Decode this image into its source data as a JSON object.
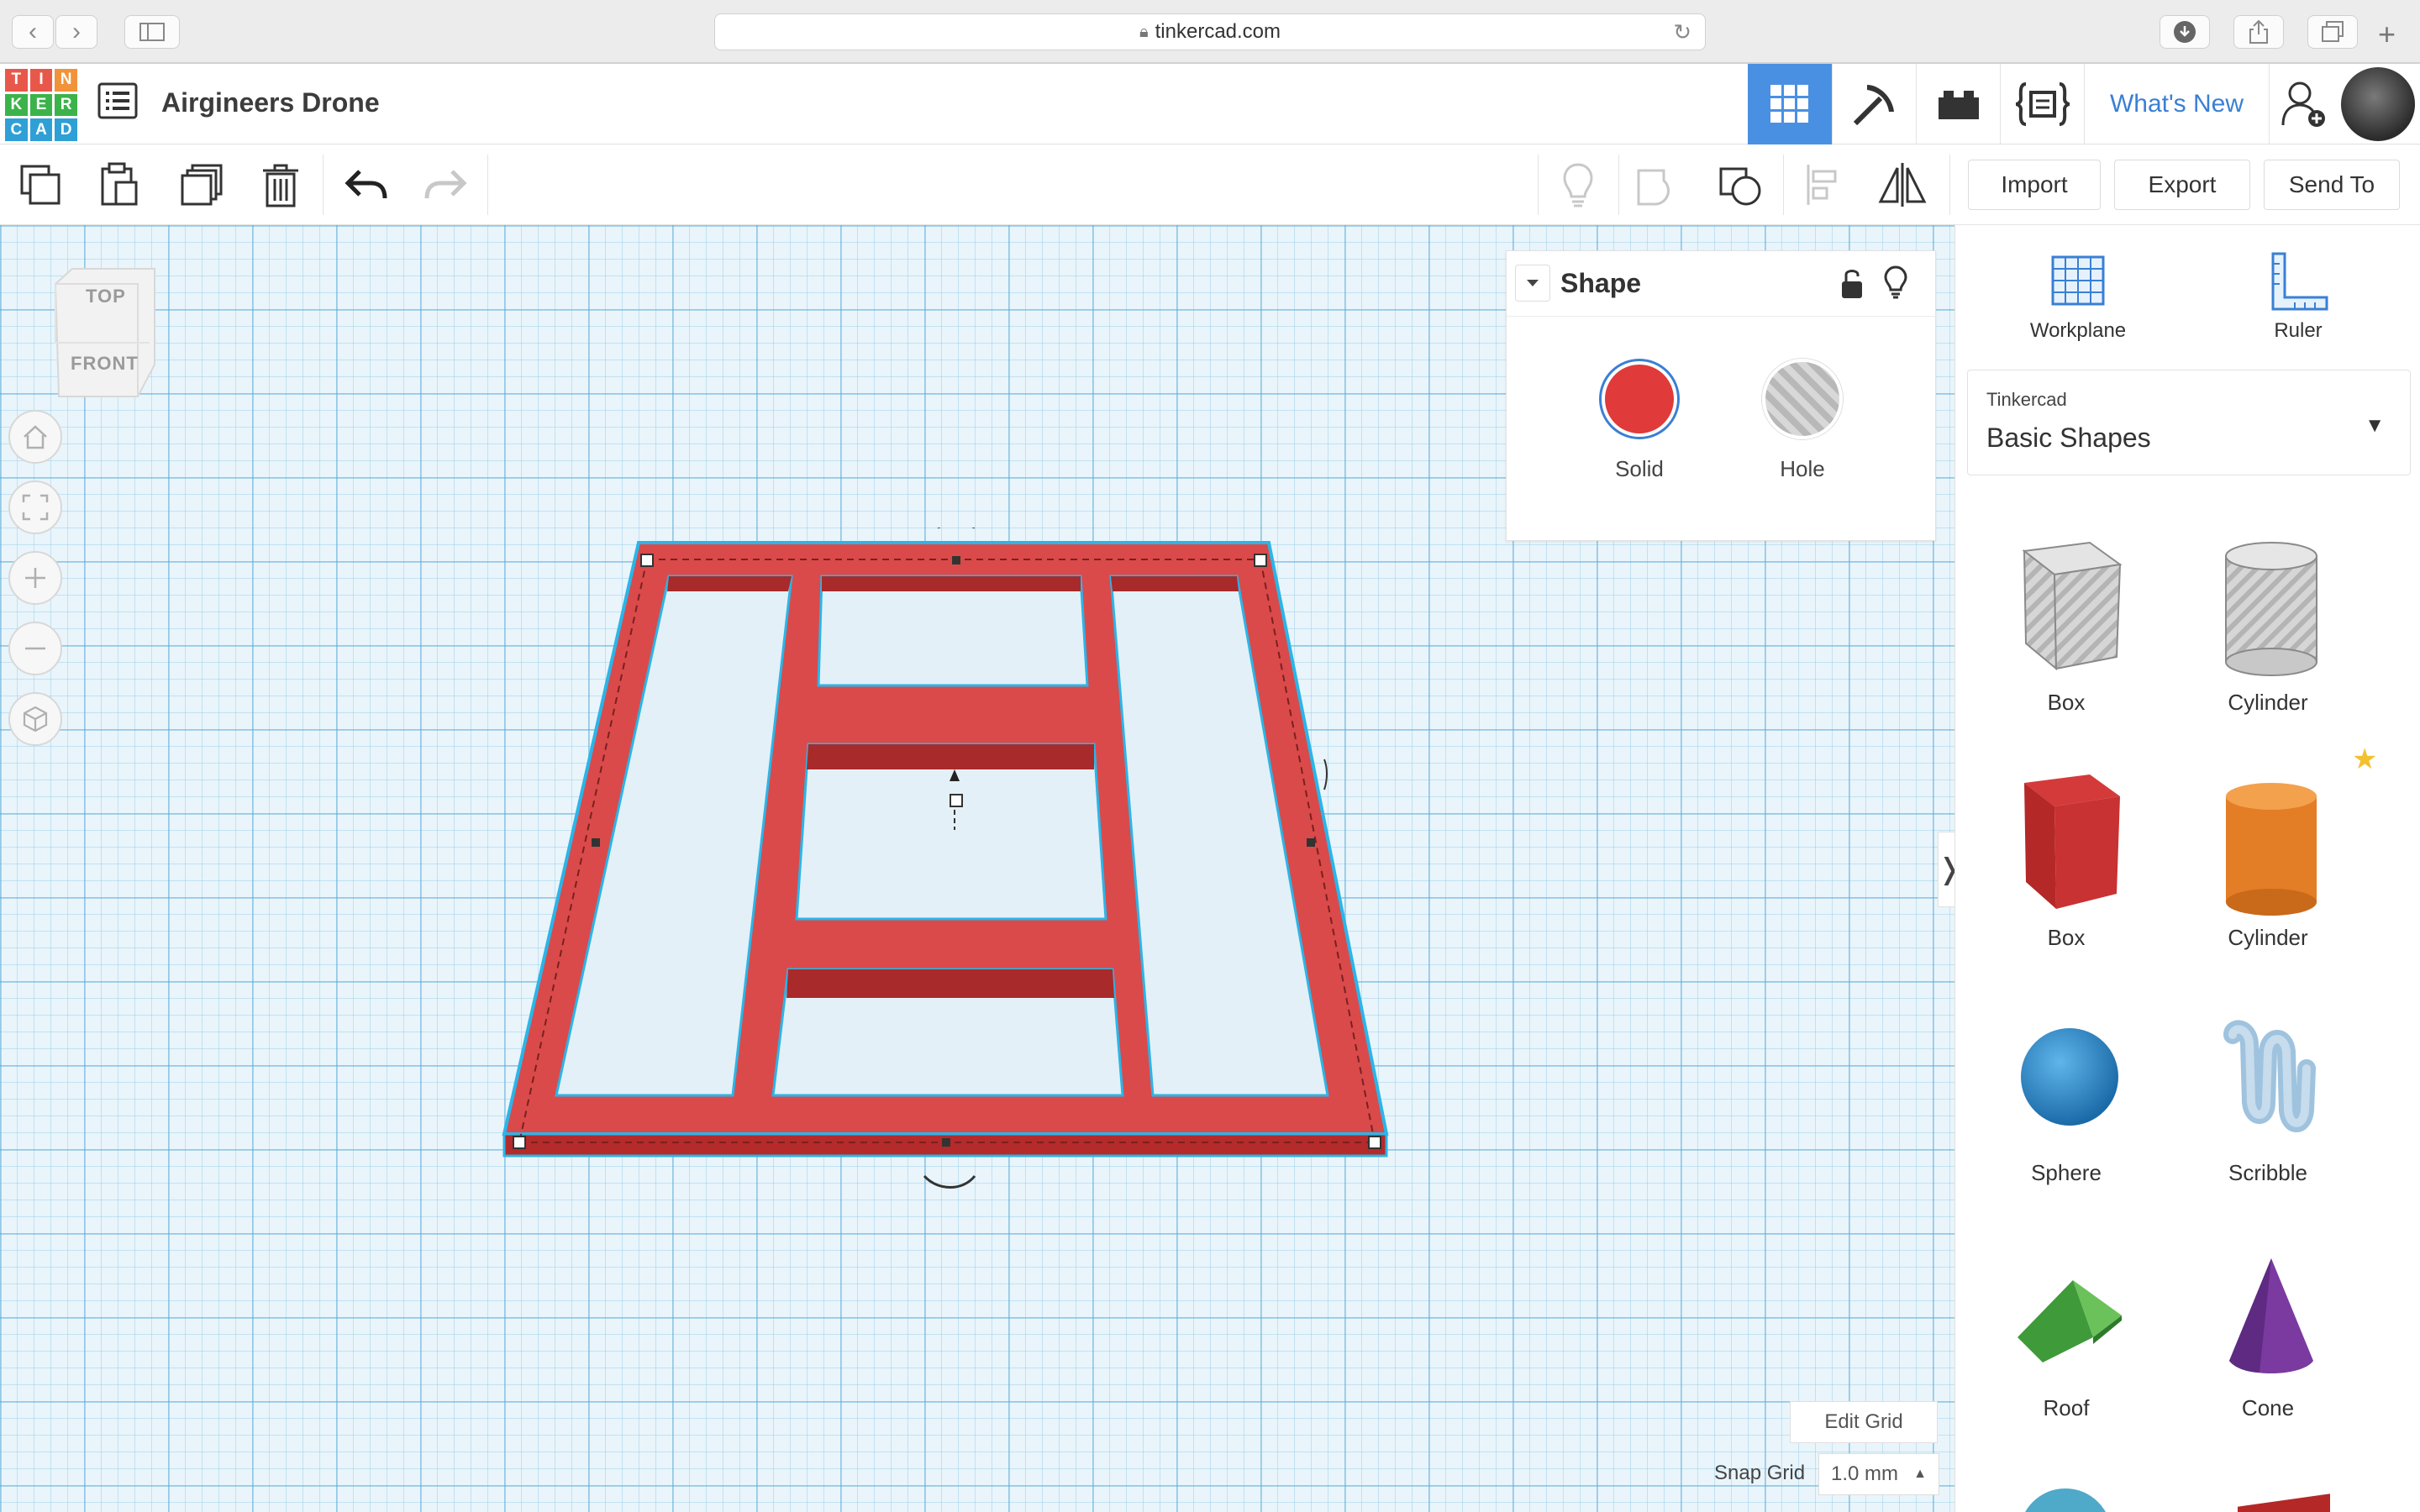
{
  "browser": {
    "url": "tinkercad.com",
    "back_glyph": "‹",
    "forward_glyph": "›"
  },
  "logo": {
    "letters": [
      "T",
      "I",
      "N",
      "K",
      "E",
      "R",
      "C",
      "A",
      "D"
    ],
    "colors": [
      "#e8584a",
      "#e8584a",
      "#f0933a",
      "#3bb34a",
      "#3bb34a",
      "#3bb34a",
      "#2fa0d6",
      "#2fa0d6",
      "#2fa0d6"
    ]
  },
  "header": {
    "project_title": "Airgineers Drone",
    "whats_new": "What's New"
  },
  "toolbar": {
    "import_label": "Import",
    "export_label": "Export",
    "send_to_label": "Send To"
  },
  "view_cube": {
    "top_label": "TOP",
    "front_label": "FRONT"
  },
  "shape_panel": {
    "title": "Shape",
    "solid_label": "Solid",
    "hole_label": "Hole",
    "solid_color": "#e03a3a"
  },
  "library": {
    "workplane_label": "Workplane",
    "ruler_label": "Ruler",
    "provider": "Tinkercad",
    "category": "Basic Shapes",
    "shapes": [
      {
        "label": "Box",
        "icon": "box-hole-icon"
      },
      {
        "label": "Cylinder",
        "icon": "cylinder-hole-icon"
      },
      {
        "label": "Box",
        "icon": "box-red-icon"
      },
      {
        "label": "Cylinder",
        "icon": "cylinder-orange-icon"
      },
      {
        "label": "Sphere",
        "icon": "sphere-icon"
      },
      {
        "label": "Scribble",
        "icon": "scribble-icon"
      },
      {
        "label": "Roof",
        "icon": "roof-icon"
      },
      {
        "label": "Cone",
        "icon": "cone-icon"
      }
    ]
  },
  "grid": {
    "edit_grid": "Edit Grid",
    "snap_grid_label": "Snap Grid",
    "snap_grid_value": "1.0 mm"
  },
  "colors": {
    "accent": "#3a7fd5",
    "selection_outline": "#2bb5e8",
    "model_red": "#d23b3b"
  }
}
